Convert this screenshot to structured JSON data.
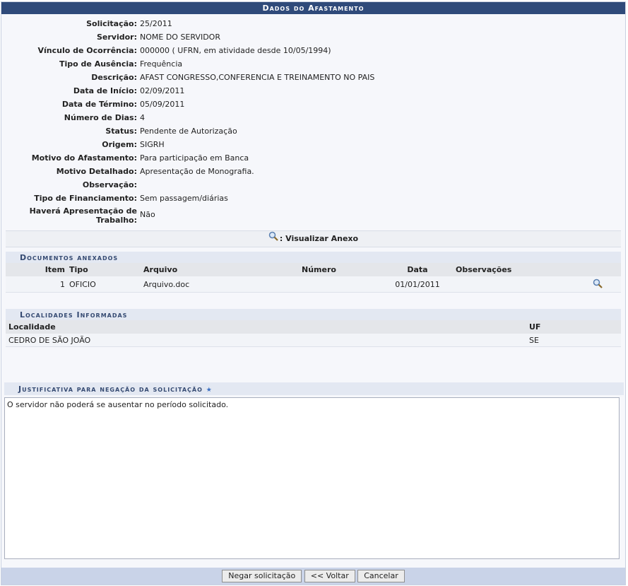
{
  "caption": "Dados do Afastamento",
  "fields": [
    {
      "label": "Solicitação:",
      "value": "25/2011"
    },
    {
      "label": "Servidor:",
      "value": "NOME DO SERVIDOR"
    },
    {
      "label": "Vínculo de Ocorrência:",
      "value": "000000 ( UFRN, em atividade desde 10/05/1994)"
    },
    {
      "label": "Tipo de Ausência:",
      "value": "Frequência"
    },
    {
      "label": "Descrição:",
      "value": "AFAST CONGRESSO,CONFERENCIA E TREINAMENTO NO PAIS"
    },
    {
      "label": "Data de Início:",
      "value": "02/09/2011"
    },
    {
      "label": "Data de Término:",
      "value": "05/09/2011"
    },
    {
      "label": "Número de Dias:",
      "value": "4"
    },
    {
      "label": "Status:",
      "value": "Pendente de Autorização"
    },
    {
      "label": "Origem:",
      "value": "SIGRH"
    },
    {
      "label": "Motivo do Afastamento:",
      "value": "Para participação em Banca"
    },
    {
      "label": "Motivo Detalhado:",
      "value": "Apresentação de Monografia."
    },
    {
      "label": "Observação:",
      "value": ""
    },
    {
      "label": "Tipo de Financiamento:",
      "value": "Sem passagem/diárias"
    }
  ],
  "apresentacao": {
    "label_line1": "Haverá Apresentação de",
    "label_line2": "Trabalho:",
    "value": "Não"
  },
  "anexo_link": ": Visualizar Anexo",
  "documentos": {
    "title": "Documentos anexados",
    "headers": {
      "item": "Item",
      "tipo": "Tipo",
      "arquivo": "Arquivo",
      "numero": "Número",
      "data": "Data",
      "obs": "Observações"
    },
    "rows": [
      {
        "item": "1",
        "tipo": "OFICIO",
        "arquivo": "Arquivo.doc",
        "numero": "",
        "data": "01/01/2011",
        "obs": ""
      }
    ]
  },
  "localidades": {
    "title": "Localidades Informadas",
    "headers": {
      "localidade": "Localidade",
      "uf": "UF"
    },
    "rows": [
      {
        "localidade": "CEDRO DE SÃO JOÃO",
        "uf": "SE"
      }
    ]
  },
  "justificativa": {
    "title": "Justificativa para negação da solicitação",
    "star": "★",
    "text": "O servidor não poderá se ausentar no período solicitado."
  },
  "buttons": {
    "negar": "Negar solicitação",
    "voltar": "<< Voltar",
    "cancelar": "Cancelar"
  },
  "colors": {
    "caption_bg": "#2f4a7a",
    "subhead_bg": "#e3e8f2",
    "footer_bg": "#c9d3e8"
  }
}
